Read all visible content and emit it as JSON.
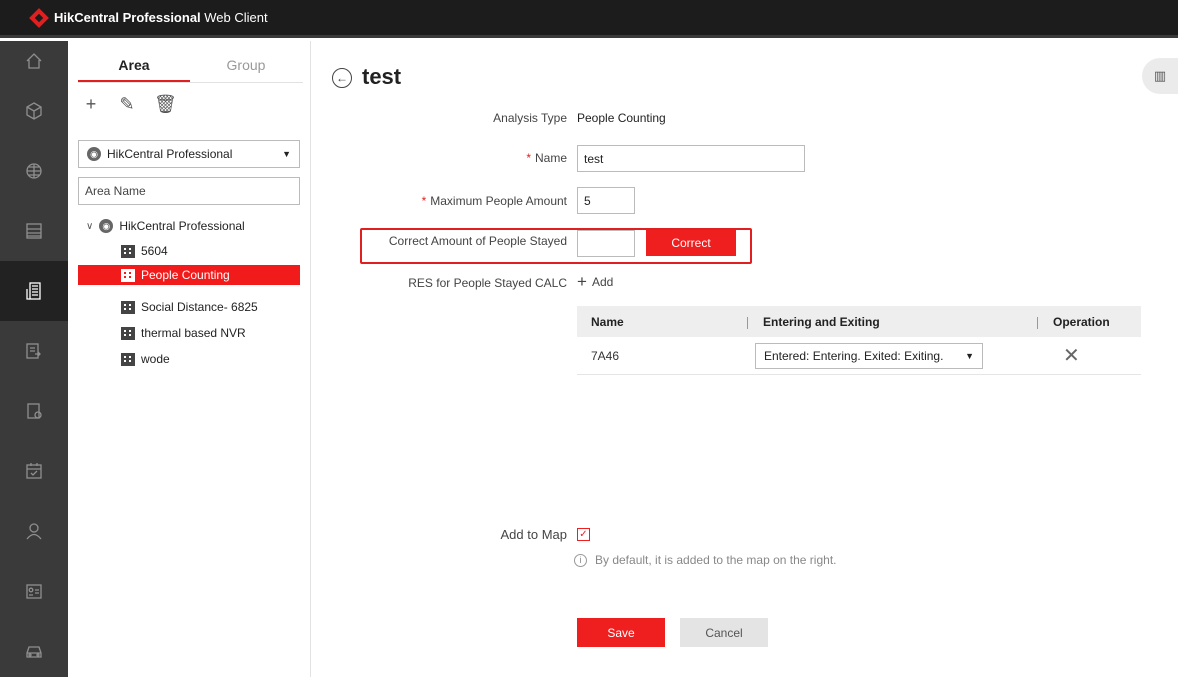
{
  "app": {
    "title_bold": "HikCentral Professional",
    "title_thin": " Web Client"
  },
  "rail": [
    "home-icon",
    "cube-icon",
    "globe-icon",
    "server-icon",
    "building-icon",
    "event-icon",
    "device-report-icon",
    "calendar-icon",
    "person-icon",
    "id-card-icon",
    "vehicle-icon"
  ],
  "tabs": {
    "area": "Area",
    "group": "Group"
  },
  "tools": {
    "add": "+",
    "edit": "✎",
    "delete": "🗑"
  },
  "site_select": {
    "value": "HikCentral Professional"
  },
  "search": {
    "placeholder": "Area Name"
  },
  "tree": {
    "root": "HikCentral Professional",
    "items": [
      "5604",
      "People Counting",
      "Social Distance- 6825",
      "thermal based NVR",
      "wode"
    ]
  },
  "page": {
    "title": "test"
  },
  "form": {
    "analysis_type_label": "Analysis Type",
    "analysis_type_value": "People Counting",
    "name_label": "Name",
    "name_value": "test",
    "max_people_label": "Maximum People Amount",
    "max_people_value": "5",
    "correct_label": "Correct Amount of People Stayed",
    "correct_value": "",
    "correct_button": "Correct",
    "res_label": "RES for People Stayed CALC",
    "add_label": "Add",
    "required_mark": "*"
  },
  "table": {
    "headers": [
      "Name",
      "Entering and Exiting",
      "Operation"
    ],
    "rows": [
      {
        "name": "7A46",
        "mode": "Entered: Entering. Exited: Exiting."
      }
    ]
  },
  "map": {
    "add_to_map_label": "Add to Map",
    "hint": "By default, it is added to the map on the right."
  },
  "buttons": {
    "save": "Save",
    "cancel": "Cancel"
  },
  "colors": {
    "accent": "#ef1f1f",
    "titlebar": "#1c1c1c",
    "rail": "#3a3a3a"
  }
}
